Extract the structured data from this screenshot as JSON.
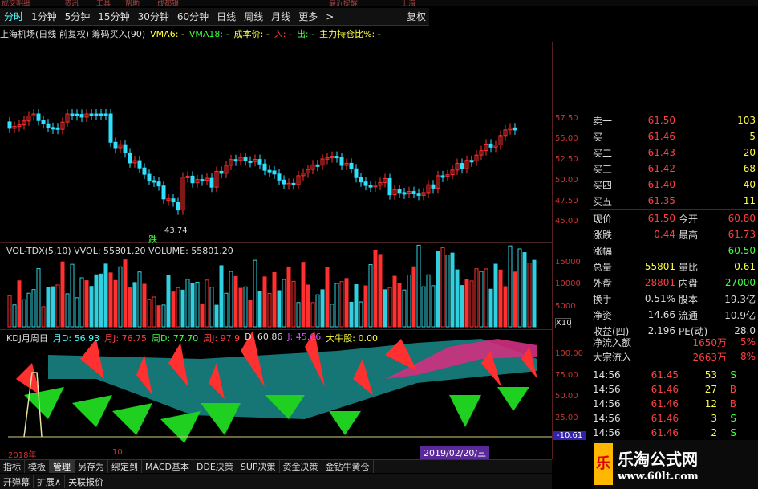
{
  "top_strip": [
    "成交明细",
    "资讯",
    "工具",
    "帮助",
    "成都银",
    "最近提醒",
    "上海"
  ],
  "periods": [
    "分时",
    "1分钟",
    "5分钟",
    "15分钟",
    "30分钟",
    "60分钟",
    "日线",
    "周线",
    "月线",
    "更多"
  ],
  "more_arrow": ">",
  "view_info": "复权",
  "title": {
    "name": "上海机场(日线 前复权) 筹码买入(90)",
    "vma6": "VMA6: -",
    "vma18": "VMA18: -",
    "cost": "成本价: -",
    "in": "入: -",
    "out": "出: -",
    "hold": "主力持仓比%: -"
  },
  "price_axis": [
    "57.50",
    "55.00",
    "52.50",
    "50.00",
    "47.50",
    "45.00"
  ],
  "low_label": "43.74",
  "low_marker": "跌",
  "vol_title": "VOL-TDX(5,10) VVOL: 55801.20  VOLUME: 55801.20",
  "vol_axis": [
    "15000",
    "10000",
    "5000"
  ],
  "vol_unit": "X10",
  "kdj_title": {
    "name": "KDJ月周日",
    "d_month": "月D: 56.93",
    "j_month": "月J: 76.75",
    "d_week": "周D: 77.70",
    "j_week": "周J: 97.9",
    "d_day": "D: 60.86",
    "j_day": "J: 45.66",
    "big_cow": "大牛股: 0.00"
  },
  "kdj_axis": [
    "100.00",
    "75.00",
    "50.00",
    "25.00"
  ],
  "kdj_value": "-10.61",
  "x_labels": [
    "2018年",
    "10"
  ],
  "cursor_date": "2019/02/20/三",
  "quote": [
    {
      "label": "卖一",
      "value": "61.50",
      "qty": "103"
    },
    {
      "label": "买一",
      "value": "61.46",
      "qty": "5"
    },
    {
      "label": "买二",
      "value": "61.43",
      "qty": "20"
    },
    {
      "label": "买三",
      "value": "61.42",
      "qty": "68"
    },
    {
      "label": "买四",
      "value": "61.40",
      "qty": "40"
    },
    {
      "label": "买五",
      "value": "61.35",
      "qty": "11"
    }
  ],
  "stats": [
    {
      "l1": "现价",
      "v1": "61.50",
      "l2": "今开",
      "v2": "60.80"
    },
    {
      "l1": "涨跌",
      "v1": "0.44",
      "l2": "最高",
      "v2": "61.73"
    },
    {
      "l1": "涨幅",
      "v1": "",
      "l2": "",
      "v2": "60.50"
    },
    {
      "l1": "总量",
      "v1": "55801",
      "l2": "量比",
      "v2": "0.61"
    },
    {
      "l1": "外盘",
      "v1": "28801",
      "l2": "内盘",
      "v2": "27000"
    },
    {
      "l1": "换手",
      "v1": "0.51%",
      "l2": "股本",
      "v2": "19.3亿"
    },
    {
      "l1": "净资",
      "v1": "14.66",
      "l2": "流通",
      "v2": "10.9亿"
    },
    {
      "l1": "收益(四)",
      "v1": "2.196",
      "l2": "PE(动)",
      "v2": "28.0"
    }
  ],
  "flows": [
    {
      "label": "净流入额",
      "value": "1650万",
      "pct": "5%"
    },
    {
      "label": "大宗流入",
      "value": "2663万",
      "pct": "8%"
    }
  ],
  "ticks": [
    {
      "time": "14:56",
      "price": "61.45",
      "vol": "53",
      "side": "S"
    },
    {
      "time": "14:56",
      "price": "61.46",
      "vol": "27",
      "side": "B"
    },
    {
      "time": "14:56",
      "price": "61.46",
      "vol": "12",
      "side": "B"
    },
    {
      "time": "14:56",
      "price": "61.46",
      "vol": "3",
      "side": "S"
    },
    {
      "time": "14:56",
      "price": "61.46",
      "vol": "2",
      "side": "S"
    }
  ],
  "bottom_tabs_1": [
    "指标",
    "模板",
    "管理",
    "另存为",
    "绑定到",
    "MACD基本",
    "DDE决策",
    "SUP决策",
    "资金决策",
    "金钻牛黄仓"
  ],
  "bottom_tabs_2": [
    "开弹幕",
    "扩展∧",
    "关联报价"
  ],
  "logo": {
    "cn": "乐淘公式网",
    "url": "www.60lt.com",
    "badge": "乐"
  },
  "colors": {
    "up": "#ff3030",
    "down": "#30e0ff",
    "kdj_green": "#20d020",
    "kdj_teal": "#1a8a8a",
    "kdj_magenta": "#d03080"
  }
}
